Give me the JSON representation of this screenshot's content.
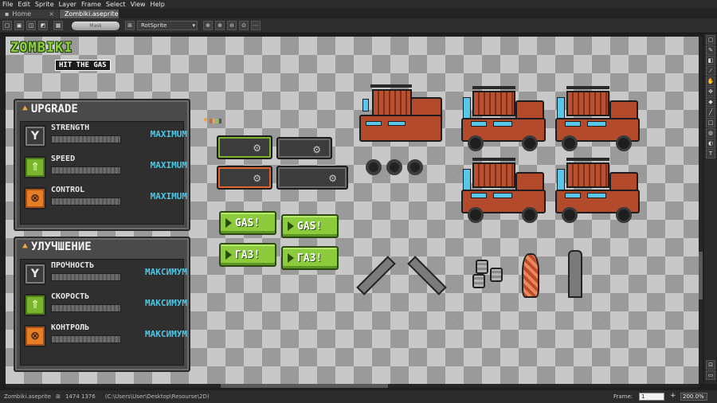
{
  "menu": [
    "File",
    "Edit",
    "Sprite",
    "Layer",
    "Frame",
    "Select",
    "View",
    "Help"
  ],
  "tabs": [
    {
      "label": "Home"
    },
    {
      "label": "Zombiki.aseprite"
    }
  ],
  "toolbar": {
    "mask_label": "Mask",
    "rotation_algorithm": "RotSprite"
  },
  "logo": {
    "line1": "ZOMBIKI",
    "line2": "HIT THE GAS"
  },
  "panel_en": {
    "title": "UPGRADE",
    "rows": [
      {
        "label": "STRENGTH",
        "value": "MAXIMUM"
      },
      {
        "label": "SPEED",
        "value": "MAXIMUM"
      },
      {
        "label": "CONTROL",
        "value": "MAXIMUM"
      }
    ]
  },
  "panel_ru": {
    "title": "УЛУЧШЕНИЕ",
    "rows": [
      {
        "label": "ПРОЧНОСТЬ",
        "value": "МАКСИМУМ"
      },
      {
        "label": "СКОРОСТЬ",
        "value": "МАКСИМУМ"
      },
      {
        "label": "КОНТРОЛЬ",
        "value": "МАКСИМУМ"
      }
    ]
  },
  "gas_buttons": [
    "GAS!",
    "GAS!",
    "ГАЗ!",
    "ГАЗ!"
  ],
  "status": {
    "filename": "Zombiki.aseprite",
    "dimensions": "1474 1376",
    "path": "(C:\\Users\\User\\Desktop\\Resourse\\2D)",
    "frame_label": "Frame:",
    "frame_value": "1",
    "zoom": "200.0%"
  },
  "colors": {
    "accent_green": "#8ccb3c",
    "accent_orange": "#e77d24",
    "value_cyan": "#4cc8e6"
  },
  "icons": {
    "wrench": "wrench-icon",
    "speed": "double-chevron-up-icon",
    "control": "steering-wheel-icon"
  }
}
